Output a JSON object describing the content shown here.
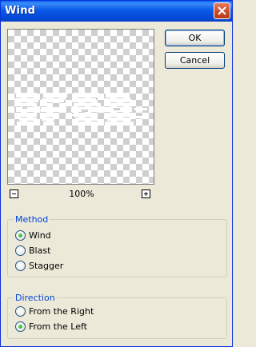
{
  "window": {
    "title": "Wind"
  },
  "preview": {
    "zoom": "100%"
  },
  "buttons": {
    "ok": "OK",
    "cancel": "Cancel"
  },
  "method": {
    "legend": "Method",
    "options": [
      {
        "label": "Wind",
        "selected": true
      },
      {
        "label": "Blast",
        "selected": false
      },
      {
        "label": "Stagger",
        "selected": false
      }
    ]
  },
  "direction": {
    "legend": "Direction",
    "options": [
      {
        "label": "From the Right",
        "selected": false
      },
      {
        "label": "From the Left",
        "selected": true
      }
    ]
  },
  "colors": {
    "titlebar": "#0a5ae8",
    "legend": "#0046d5",
    "dialog_bg": "#ece9d8",
    "radio_dot": "#21a121"
  }
}
